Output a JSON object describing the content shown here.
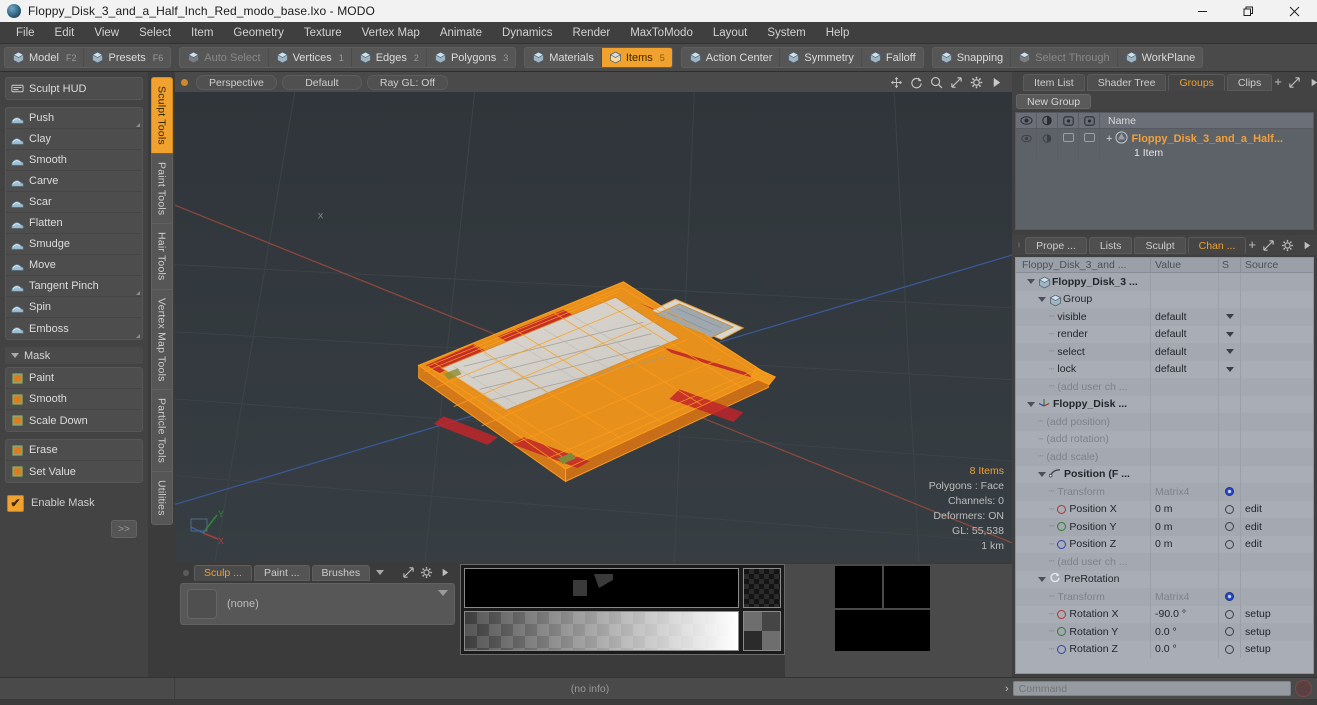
{
  "window": {
    "title": "Floppy_Disk_3_and_a_Half_Inch_Red_modo_base.lxo - MODO",
    "minimize_label": "Minimize",
    "restore_label": "Restore",
    "close_label": "Close"
  },
  "menubar": {
    "items": [
      {
        "label": "File"
      },
      {
        "label": "Edit"
      },
      {
        "label": "View"
      },
      {
        "label": "Select"
      },
      {
        "label": "Item"
      },
      {
        "label": "Geometry"
      },
      {
        "label": "Texture"
      },
      {
        "label": "Vertex Map"
      },
      {
        "label": "Animate"
      },
      {
        "label": "Dynamics"
      },
      {
        "label": "Render"
      },
      {
        "label": "MaxToModo"
      },
      {
        "label": "Layout"
      },
      {
        "label": "System"
      },
      {
        "label": "Help"
      }
    ]
  },
  "toolbar": {
    "group1": [
      {
        "label": "Model",
        "shortcut": "F2",
        "icon": "sphere-icon",
        "active": false,
        "dim": false
      },
      {
        "label": "Presets",
        "shortcut": "F6",
        "icon": "halfsphere-icon",
        "active": false,
        "dim": false
      }
    ],
    "group2": [
      {
        "label": "Auto Select",
        "shortcut": "",
        "icon": "cube-icon",
        "active": false,
        "dim": true
      },
      {
        "label": "Vertices",
        "shortcut": "1",
        "icon": "cube-icon",
        "active": false,
        "dim": false
      },
      {
        "label": "Edges",
        "shortcut": "2",
        "icon": "cube-icon",
        "active": false,
        "dim": false
      },
      {
        "label": "Polygons",
        "shortcut": "3",
        "icon": "cube-icon",
        "active": false,
        "dim": false
      }
    ],
    "group3": [
      {
        "label": "Materials",
        "shortcut": "",
        "icon": "cube-icon",
        "active": false,
        "dim": false
      },
      {
        "label": "Items",
        "shortcut": "5",
        "icon": "cube-icon",
        "active": true,
        "dim": false
      }
    ],
    "group4": [
      {
        "label": "Action Center",
        "shortcut": "",
        "icon": "crosshair-icon",
        "active": false,
        "dim": false
      },
      {
        "label": "Symmetry",
        "shortcut": "",
        "icon": "symmetry-icon",
        "active": false,
        "dim": false
      },
      {
        "label": "Falloff",
        "shortcut": "",
        "icon": "falloff-icon",
        "active": false,
        "dim": false
      }
    ],
    "group5": [
      {
        "label": "Snapping",
        "shortcut": "",
        "icon": "snap-icon",
        "active": false,
        "dim": false
      },
      {
        "label": "Select Through",
        "shortcut": "",
        "icon": "selectthrough-icon",
        "active": false,
        "dim": true
      },
      {
        "label": "WorkPlane",
        "shortcut": "",
        "icon": "workplane-icon",
        "active": false,
        "dim": false
      }
    ]
  },
  "left_panel": {
    "hud_label": "Sculpt HUD",
    "sculpt_tools": [
      {
        "label": "Push",
        "corner": true
      },
      {
        "label": "Clay",
        "corner": false
      },
      {
        "label": "Smooth",
        "corner": false
      },
      {
        "label": "Carve",
        "corner": false
      },
      {
        "label": "Scar",
        "corner": false
      },
      {
        "label": "Flatten",
        "corner": false
      },
      {
        "label": "Smudge",
        "corner": false
      },
      {
        "label": "Move",
        "corner": false
      },
      {
        "label": "Tangent Pinch",
        "corner": true
      },
      {
        "label": "Spin",
        "corner": false
      },
      {
        "label": "Emboss",
        "corner": true
      }
    ],
    "mask_section_label": "Mask",
    "mask_tools": [
      {
        "label": "Paint"
      },
      {
        "label": "Smooth"
      },
      {
        "label": "Scale Down"
      }
    ],
    "mask_tools2": [
      {
        "label": "Erase"
      },
      {
        "label": "Set Value"
      }
    ],
    "enable_mask_label": "Enable Mask",
    "enable_mask_checked": true,
    "more_label": ">>"
  },
  "vertical_tabs": [
    {
      "label": "Sculpt Tools",
      "active": true
    },
    {
      "label": "Paint Tools",
      "active": false
    },
    {
      "label": "Hair Tools",
      "active": false
    },
    {
      "label": "Vertex Map Tools",
      "active": false
    },
    {
      "label": "Particle Tools",
      "active": false
    },
    {
      "label": "Utilities",
      "active": false
    }
  ],
  "viewport": {
    "header": {
      "view_mode": "Perspective",
      "shading": "Default",
      "raygl": "Ray GL: Off",
      "icons": [
        "move-icon",
        "rotate-icon",
        "zoom-icon",
        "fit-icon",
        "gear-icon",
        "play-icon"
      ]
    },
    "stats": {
      "items": "8 Items",
      "polygons": "Polygons : Face",
      "channels": "Channels: 0",
      "deformers": "Deformers: ON",
      "gl": "GL: 55,538",
      "scale": "1 km"
    },
    "axis_labels": {
      "x": "X",
      "y": "Y",
      "z": "Z"
    },
    "model_name": "floppy-disk-wireframe",
    "bg_color": "#333a3f",
    "wire_color": "#ffa31a",
    "mesh_color": "#c8262a"
  },
  "bottom_panel": {
    "tabs": [
      {
        "label": "Sculp ...",
        "active": true
      },
      {
        "label": "Paint ...",
        "active": false
      },
      {
        "label": "Brushes",
        "active": false
      }
    ],
    "preset_value": "(none)"
  },
  "right_panel": {
    "top_tabs": [
      {
        "label": "Item List",
        "active": false
      },
      {
        "label": "Shader Tree",
        "active": false
      },
      {
        "label": "Groups",
        "active": true
      },
      {
        "label": "Clips",
        "active": false
      }
    ],
    "new_group_label": "New Group",
    "groups_header": {
      "columns": [
        "eye-icon",
        "render-icon",
        "select-icon",
        "lock-icon"
      ],
      "name": "Name"
    },
    "groups_rows": [
      {
        "name": "Floppy_Disk_3_and_a_Half...",
        "sub": "1 Item"
      }
    ],
    "channel_tabs": [
      {
        "label": "Prope ...",
        "active": false
      },
      {
        "label": "Lists",
        "active": false
      },
      {
        "label": "Sculpt",
        "active": false
      },
      {
        "label": "Chan ...",
        "active": true
      }
    ],
    "channel_header": [
      "Floppy_Disk_3_and ...",
      "Value",
      "S",
      "Source"
    ],
    "channel_rows": [
      {
        "indent": 0,
        "marker": "tri",
        "icon": "cube-icon",
        "name": "Floppy_Disk_3 ...",
        "value": "",
        "s": "",
        "source": "",
        "bold": true,
        "muted": false
      },
      {
        "indent": 1,
        "marker": "tri",
        "icon": "cube-icon",
        "name": "Group",
        "value": "",
        "s": "",
        "source": "",
        "bold": false,
        "muted": false
      },
      {
        "indent": 2,
        "marker": "dash",
        "icon": "",
        "name": "visible",
        "value": "default",
        "s": "caret",
        "source": "",
        "bold": false,
        "muted": false
      },
      {
        "indent": 2,
        "marker": "dash",
        "icon": "",
        "name": "render",
        "value": "default",
        "s": "caret",
        "source": "",
        "bold": false,
        "muted": false
      },
      {
        "indent": 2,
        "marker": "dash",
        "icon": "",
        "name": "select",
        "value": "default",
        "s": "caret",
        "source": "",
        "bold": false,
        "muted": false
      },
      {
        "indent": 2,
        "marker": "dash",
        "icon": "",
        "name": "lock",
        "value": "default",
        "s": "caret",
        "source": "",
        "bold": false,
        "muted": false
      },
      {
        "indent": 2,
        "marker": "dash",
        "icon": "",
        "name": "(add user ch ...",
        "value": "",
        "s": "",
        "source": "",
        "bold": false,
        "muted": true
      },
      {
        "indent": 0,
        "marker": "tri",
        "icon": "axis-icon",
        "name": "Floppy_Disk ...",
        "value": "",
        "s": "",
        "source": "",
        "bold": true,
        "muted": false
      },
      {
        "indent": 1,
        "marker": "dash",
        "icon": "",
        "name": "(add position)",
        "value": "",
        "s": "",
        "source": "",
        "bold": false,
        "muted": true
      },
      {
        "indent": 1,
        "marker": "dash",
        "icon": "",
        "name": "(add rotation)",
        "value": "",
        "s": "",
        "source": "",
        "bold": false,
        "muted": true
      },
      {
        "indent": 1,
        "marker": "dash",
        "icon": "",
        "name": "(add scale)",
        "value": "",
        "s": "",
        "source": "",
        "bold": false,
        "muted": true
      },
      {
        "indent": 1,
        "marker": "tri",
        "icon": "pos-icon",
        "name": "Position (F ...",
        "value": "",
        "s": "",
        "source": "",
        "bold": true,
        "muted": false
      },
      {
        "indent": 2,
        "marker": "dash",
        "icon": "",
        "name": "Transform",
        "value": "Matrix4",
        "s": "gear",
        "source": "",
        "bold": false,
        "muted": true
      },
      {
        "indent": 2,
        "marker": "dash",
        "icon": "ring-r",
        "name": "Position X",
        "value": "0 m",
        "s": "ring",
        "source": "edit",
        "bold": false,
        "muted": false
      },
      {
        "indent": 2,
        "marker": "dash",
        "icon": "ring-g",
        "name": "Position Y",
        "value": "0 m",
        "s": "ring",
        "source": "edit",
        "bold": false,
        "muted": false
      },
      {
        "indent": 2,
        "marker": "dash",
        "icon": "ring-b",
        "name": "Position Z",
        "value": "0 m",
        "s": "ring",
        "source": "edit",
        "bold": false,
        "muted": false
      },
      {
        "indent": 2,
        "marker": "dash",
        "icon": "",
        "name": "(add user ch ...",
        "value": "",
        "s": "",
        "source": "",
        "bold": false,
        "muted": true
      },
      {
        "indent": 1,
        "marker": "tri",
        "icon": "rot-icon",
        "name": "PreRotation",
        "value": "",
        "s": "",
        "source": "",
        "bold": false,
        "muted": false
      },
      {
        "indent": 2,
        "marker": "dash",
        "icon": "",
        "name": "Transform",
        "value": "Matrix4",
        "s": "gear",
        "source": "",
        "bold": false,
        "muted": true
      },
      {
        "indent": 2,
        "marker": "dash",
        "icon": "ring-r",
        "name": "Rotation X",
        "value": "-90.0 °",
        "s": "ring",
        "source": "setup",
        "bold": false,
        "muted": false
      },
      {
        "indent": 2,
        "marker": "dash",
        "icon": "ring-g",
        "name": "Rotation Y",
        "value": "0.0 °",
        "s": "ring",
        "source": "setup",
        "bold": false,
        "muted": false
      },
      {
        "indent": 2,
        "marker": "dash",
        "icon": "ring-b",
        "name": "Rotation Z",
        "value": "0.0 °",
        "s": "ring",
        "source": "setup",
        "bold": false,
        "muted": false
      }
    ]
  },
  "statusbar": {
    "info": "(no info)",
    "command_placeholder": "Command",
    "command_value": ""
  },
  "colors": {
    "accent": "#f0a12e",
    "panel": "#434343",
    "toolbar": "#4a4a4a",
    "viewport_bg": "#333a3f",
    "channel_bg": "#a9aeb6",
    "groups_bg": "#5d6168"
  }
}
